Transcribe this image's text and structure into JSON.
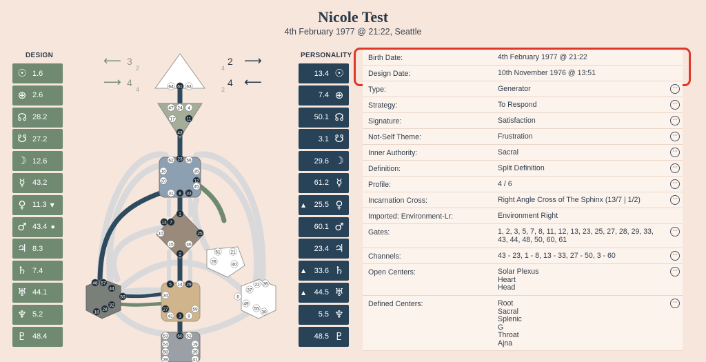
{
  "header": {
    "name": "Nicole Test",
    "subtitle": "4th February 1977 @ 21:22, Seattle"
  },
  "columns": {
    "design": "DESIGN",
    "personality": "PERSONALITY"
  },
  "arrows": {
    "left_top": {
      "num": "3",
      "sub": "2"
    },
    "left_bottom": {
      "num": "4",
      "sub": "4"
    },
    "right_top": {
      "num": "2",
      "sub": "4"
    },
    "right_bottom": {
      "num": "4",
      "sub": "2"
    }
  },
  "design": [
    {
      "icon": "sun-icon",
      "glyph": "☉",
      "value": "1.6",
      "mark": ""
    },
    {
      "icon": "earth-icon",
      "glyph": "⊕",
      "value": "2.6",
      "mark": ""
    },
    {
      "icon": "north-node-icon",
      "glyph": "☊",
      "value": "28.2",
      "mark": ""
    },
    {
      "icon": "south-node-icon",
      "glyph": "☋",
      "value": "27.2",
      "mark": ""
    },
    {
      "icon": "moon-icon",
      "glyph": "☽",
      "value": "12.6",
      "mark": ""
    },
    {
      "icon": "mercury-icon",
      "glyph": "☿",
      "value": "43.2",
      "mark": ""
    },
    {
      "icon": "venus-icon",
      "glyph": "♀",
      "value": "11.3",
      "mark": "▼"
    },
    {
      "icon": "mars-icon",
      "glyph": "♂",
      "value": "43.4",
      "mark": "✸"
    },
    {
      "icon": "jupiter-icon",
      "glyph": "♃",
      "value": "8.3",
      "mark": ""
    },
    {
      "icon": "saturn-icon",
      "glyph": "♄",
      "value": "7.4",
      "mark": ""
    },
    {
      "icon": "uranus-icon",
      "glyph": "♅",
      "value": "44.1",
      "mark": ""
    },
    {
      "icon": "neptune-icon",
      "glyph": "♆",
      "value": "5.2",
      "mark": ""
    },
    {
      "icon": "pluto-icon",
      "glyph": "♇",
      "value": "48.4",
      "mark": ""
    }
  ],
  "personality": [
    {
      "icon": "sun-icon",
      "glyph": "☉",
      "value": "13.4",
      "mark": ""
    },
    {
      "icon": "earth-icon",
      "glyph": "⊕",
      "value": "7.4",
      "mark": ""
    },
    {
      "icon": "north-node-icon",
      "glyph": "☊",
      "value": "50.1",
      "mark": ""
    },
    {
      "icon": "south-node-icon",
      "glyph": "☋",
      "value": "3.1",
      "mark": ""
    },
    {
      "icon": "moon-icon",
      "glyph": "☽",
      "value": "29.6",
      "mark": ""
    },
    {
      "icon": "mercury-icon",
      "glyph": "☿",
      "value": "61.2",
      "mark": ""
    },
    {
      "icon": "venus-icon",
      "glyph": "♀",
      "value": "25.5",
      "mark": "▲"
    },
    {
      "icon": "mars-icon",
      "glyph": "♂",
      "value": "60.1",
      "mark": ""
    },
    {
      "icon": "jupiter-icon",
      "glyph": "♃",
      "value": "23.4",
      "mark": ""
    },
    {
      "icon": "saturn-icon",
      "glyph": "♄",
      "value": "33.6",
      "mark": "▲"
    },
    {
      "icon": "uranus-icon",
      "glyph": "♅",
      "value": "44.5",
      "mark": "▲"
    },
    {
      "icon": "neptune-icon",
      "glyph": "♆",
      "value": "5.5",
      "mark": ""
    },
    {
      "icon": "pluto-icon",
      "glyph": "♇",
      "value": "48.5",
      "mark": ""
    }
  ],
  "details": [
    {
      "label": "Birth Date:",
      "value": "4th February 1977 @ 21:22",
      "more": false
    },
    {
      "label": "Design Date:",
      "value": "10th November 1976 @ 13:51",
      "more": false
    },
    {
      "label": "Type:",
      "value": "Generator",
      "more": true
    },
    {
      "label": "Strategy:",
      "value": "To Respond",
      "more": true
    },
    {
      "label": "Signature:",
      "value": "Satisfaction",
      "more": true
    },
    {
      "label": "Not-Self Theme:",
      "value": "Frustration",
      "more": true
    },
    {
      "label": "Inner Authority:",
      "value": "Sacral",
      "more": true
    },
    {
      "label": "Definition:",
      "value": "Split Definition",
      "more": true
    },
    {
      "label": "Profile:",
      "value": "4 / 6",
      "more": true
    },
    {
      "label": "Incarnation Cross:",
      "value": "Right Angle Cross of The Sphinx (13/7 | 1/2)",
      "more": true
    },
    {
      "label": "Imported: Environment-Lr:",
      "value": "Environment Right",
      "more": false
    },
    {
      "label": "Gates:",
      "value": "1, 2, 3, 5, 7, 8, 11, 12, 13, 23, 25, 27, 28, 29, 33, 43, 44, 48, 50, 60, 61",
      "more": true
    },
    {
      "label": "Channels:",
      "value": "43 - 23, 1 - 8, 13 - 33, 27 - 50, 3 - 60",
      "more": true
    },
    {
      "label": "Open Centers:",
      "value": "Solar Plexus\nHeart\nHead",
      "more": true
    },
    {
      "label": "Defined Centers:",
      "value": "Root\nSacral\nSplenic\nG\nThroat\nAjna",
      "more": true
    }
  ],
  "chart_gates": {
    "head": [
      "64",
      "61",
      "63"
    ],
    "ajna": [
      "47",
      "24",
      "4",
      "17",
      "11",
      "43"
    ],
    "throat": [
      "62",
      "23",
      "56",
      "16",
      "35",
      "20",
      "12",
      "31",
      "8",
      "33",
      "45"
    ],
    "g": [
      "1",
      "13",
      "7",
      "10",
      "25",
      "15",
      "2",
      "46"
    ],
    "heart": [
      "51",
      "21",
      "26",
      "40"
    ],
    "spleen": [
      "48",
      "57",
      "44",
      "50",
      "32",
      "28",
      "18"
    ],
    "sacral": [
      "5",
      "14",
      "29",
      "34",
      "27",
      "59",
      "42",
      "3",
      "9"
    ],
    "solar": [
      "36",
      "22",
      "37",
      "6",
      "49",
      "55",
      "30"
    ],
    "root": [
      "53",
      "60",
      "52",
      "54",
      "19",
      "58",
      "39",
      "38",
      "41"
    ]
  }
}
